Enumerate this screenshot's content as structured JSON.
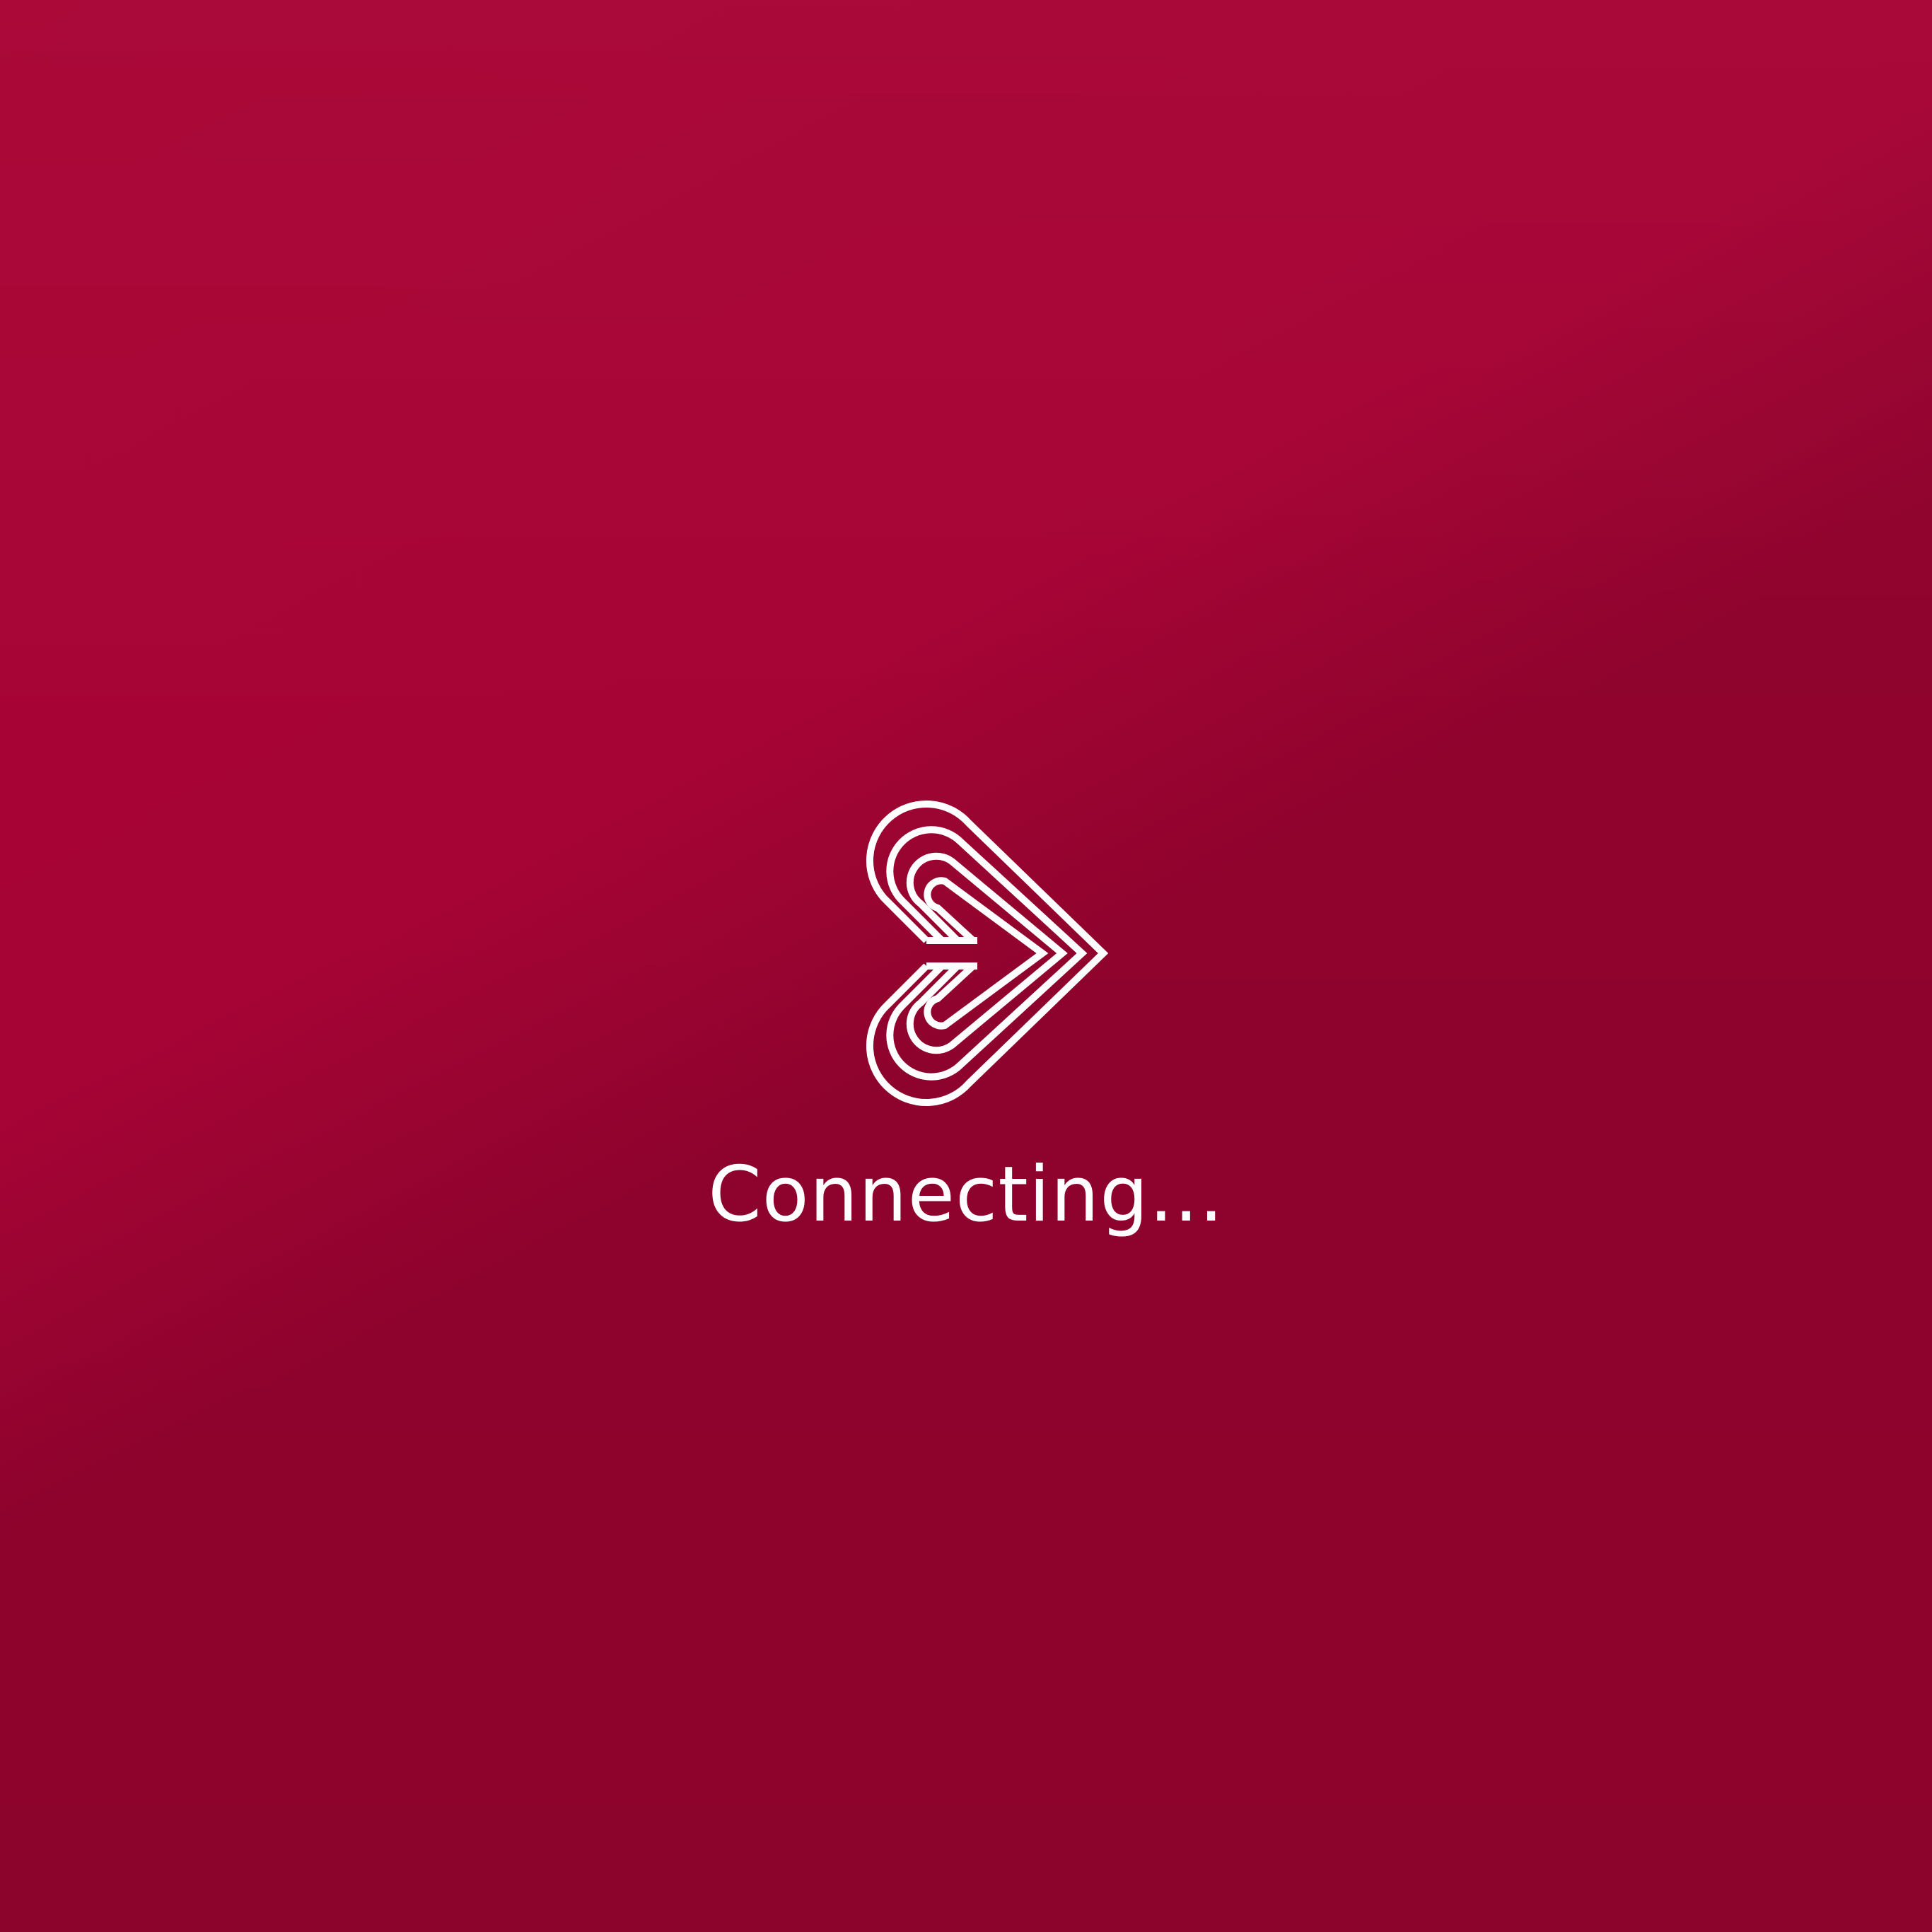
{
  "app": {
    "logo_icon": "heart-stripes-logo-icon",
    "status_text": "Connecting..."
  },
  "colors": {
    "background_light": "#a90535",
    "background_dark": "#8f032d",
    "foreground": "#ffffff"
  }
}
